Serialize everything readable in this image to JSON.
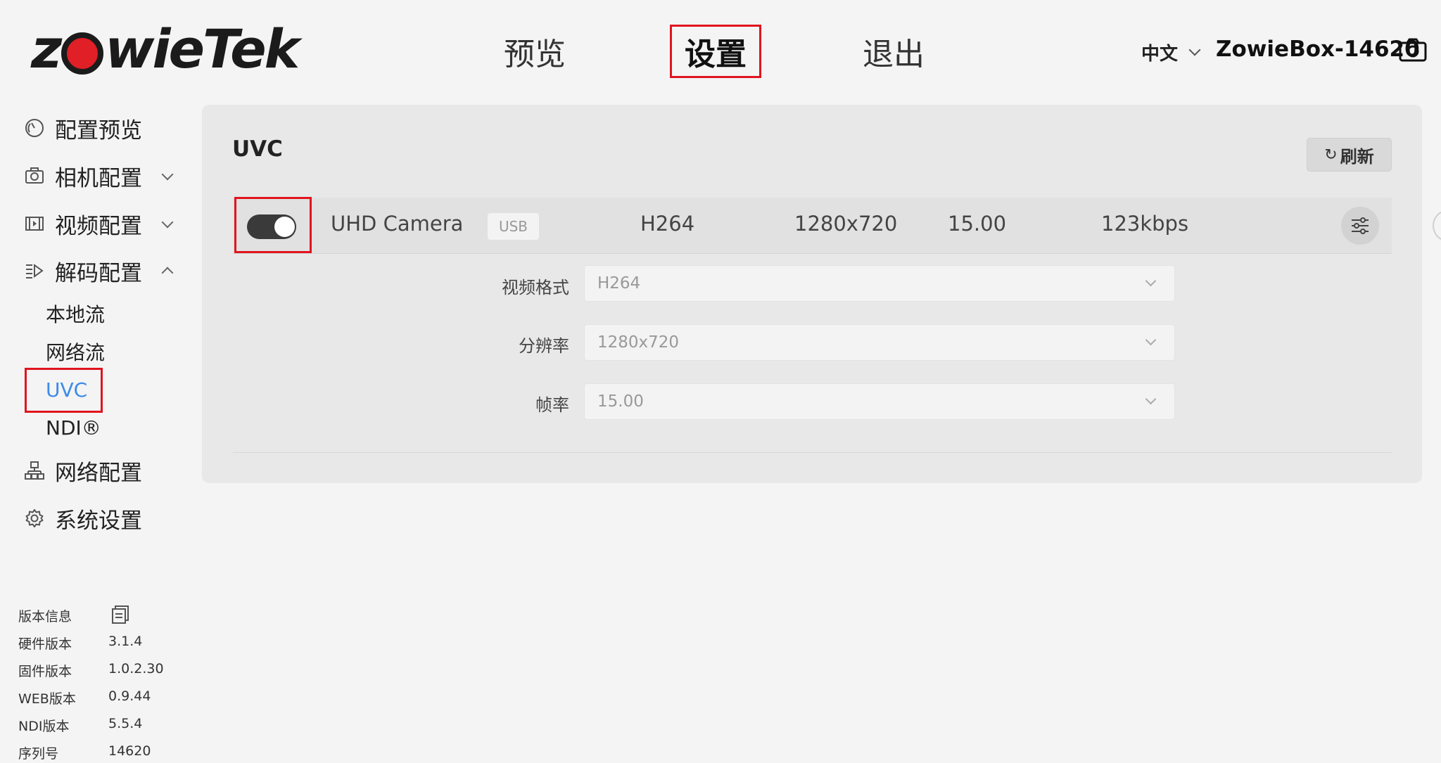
{
  "header": {
    "logo_text": "zowieTek",
    "nav": {
      "preview": "预览",
      "settings": "设置",
      "exit": "退出"
    },
    "language": "中文",
    "device_name": "ZowieBox-14620"
  },
  "sidebar": {
    "items": [
      {
        "label": "配置预览",
        "icon": "dashboard-icon"
      },
      {
        "label": "相机配置",
        "icon": "camera-icon"
      },
      {
        "label": "视频配置",
        "icon": "film-icon"
      },
      {
        "label": "解码配置",
        "icon": "decode-icon"
      },
      {
        "label": "网络配置",
        "icon": "network-icon"
      },
      {
        "label": "系统设置",
        "icon": "gear-icon"
      }
    ],
    "decode_sub": [
      "本地流",
      "网络流",
      "UVC",
      "NDI®"
    ],
    "active_sub": "UVC"
  },
  "version_info": {
    "title": "版本信息",
    "rows": [
      {
        "label": "硬件版本",
        "value": "3.1.4"
      },
      {
        "label": "固件版本",
        "value": "1.0.2.30"
      },
      {
        "label": "WEB版本",
        "value": "0.9.44"
      },
      {
        "label": "NDI版本",
        "value": "5.5.4"
      },
      {
        "label": "序列号",
        "value": "14620"
      }
    ]
  },
  "main": {
    "title": "UVC",
    "refresh_label": "刷新",
    "device_row": {
      "enabled": true,
      "name": "UHD Camera",
      "interface": "USB",
      "codec": "H264",
      "resolution": "1280x720",
      "fps": "15.00",
      "bitrate": "123kbps"
    },
    "form": {
      "format_label": "视频格式",
      "format_value": "H264",
      "resolution_label": "分辨率",
      "resolution_value": "1280x720",
      "fps_label": "帧率",
      "fps_value": "15.00"
    }
  },
  "colors": {
    "accent_red": "#e01f26",
    "active_blue": "#3d8be8",
    "highlight_border": "#e0141e"
  }
}
